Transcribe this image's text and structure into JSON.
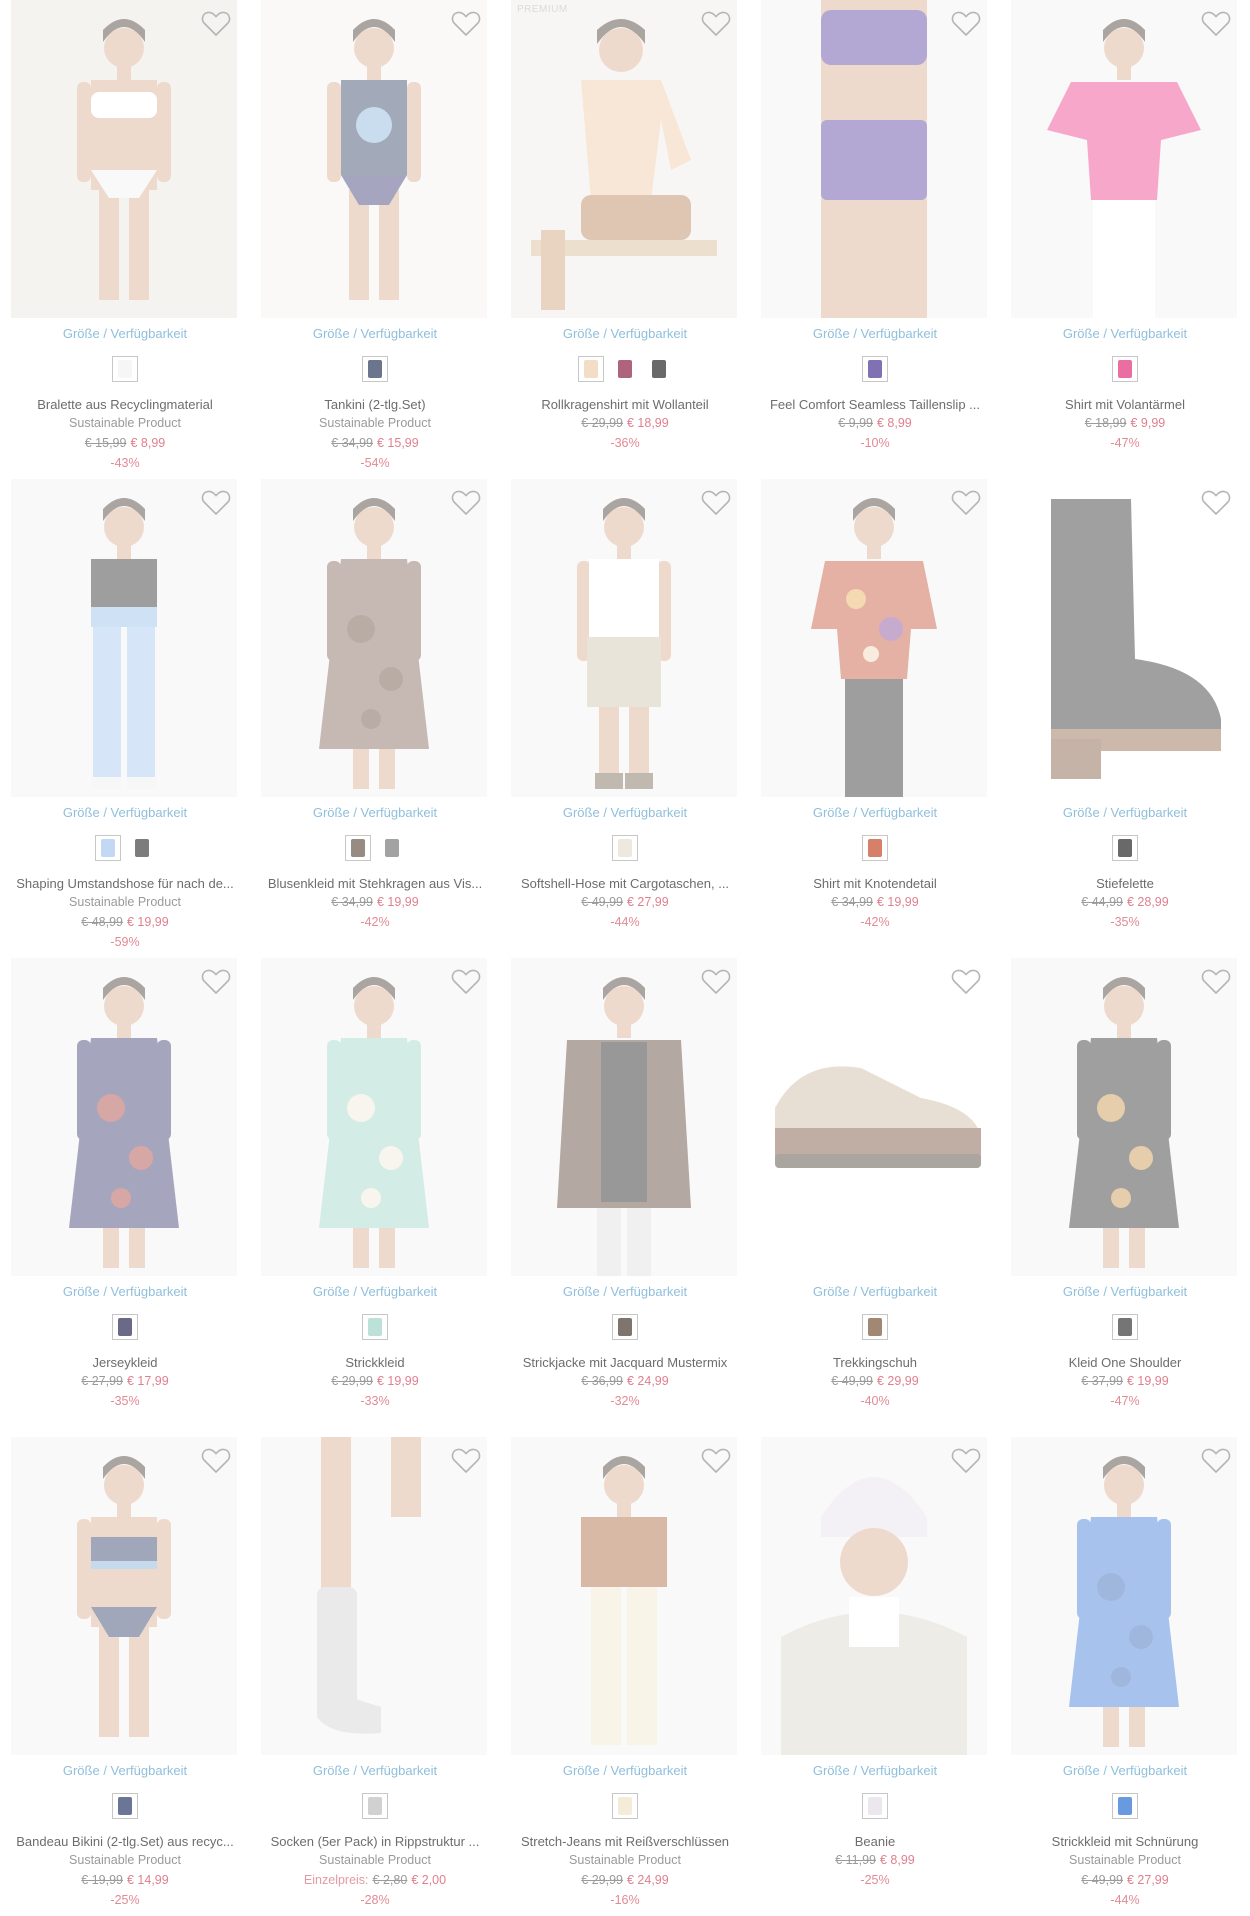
{
  "ui": {
    "size_label": "Größe / Verfügbarkeit",
    "heart_icon": "heart-outline-icon",
    "heart_color": "#b5b5b5",
    "link_color": "#8fbfdc",
    "sale_color": "#e07f8e"
  },
  "products": [
    {
      "title": "Bralette aus Recyclingmaterial",
      "subtitle": "Sustainable Product",
      "old_price": "€ 15,99",
      "price": "€ 8,99",
      "discount": "-43%",
      "swatches": [
        "#f2f2f2"
      ],
      "art": "bra",
      "bg": "#e9e4dc",
      "c1": "#ffffff",
      "c2": "#f1f1f1"
    },
    {
      "title": "Tankini (2-tlg.Set)",
      "subtitle": "Sustainable Product",
      "old_price": "€ 34,99",
      "price": "€ 15,99",
      "discount": "-54%",
      "swatches": [
        "#2d3a5e"
      ],
      "art": "tankini",
      "bg": "#f4f1ee",
      "c1": "#243457",
      "c2": "#2b2a6c"
    },
    {
      "tag": "PREMIUM",
      "title": "Rollkragenshirt mit Wollanteil",
      "old_price": "€ 29,99",
      "price": "€ 18,99",
      "discount": "-36%",
      "swatches": [
        "#efcfae",
        "#8b2344",
        "#2a2a2a"
      ],
      "art": "sit",
      "bg": "#eeeae6",
      "c1": "#efc89f",
      "c2": "#b27a4b"
    },
    {
      "title": "Feel Comfort Seamless Taillenslip ...",
      "old_price": "€ 9,99",
      "price": "€ 8,99",
      "discount": "-10%",
      "swatches": [
        "#4b3494"
      ],
      "art": "underwear",
      "bg": "#f3f2f2",
      "c1": "#4b2f98",
      "c2": "#4b2f98"
    },
    {
      "title": "Shirt mit Volantärmel",
      "old_price": "€ 18,99",
      "price": "€ 9,99",
      "discount": "-47%",
      "swatches": [
        "#e2317c"
      ],
      "art": "shirt",
      "bg": "#f4f3f3",
      "c1": "#ea2f82",
      "c2": "#ffffff"
    },
    {
      "title": "Shaping Umstandshose für nach de...",
      "subtitle": "Sustainable Product",
      "old_price": "€ 48,99",
      "price": "€ 19,99",
      "discount": "-59%",
      "swatches": [
        "#a8c8ee",
        "#444444"
      ],
      "art": "jeans",
      "bg": "#f2f2f2",
      "c1": "#1b1b1b",
      "c2": "#9ec3ef"
    },
    {
      "title": "Blusenkleid mit Stehkragen aus Vis...",
      "old_price": "€ 34,99",
      "price": "€ 19,99",
      "discount": "-42%",
      "swatches": [
        "#6b5a50",
        "#7a7a7a"
      ],
      "art": "dress",
      "bg": "#f2f2f2",
      "c1": "#7a5a4f",
      "c2": "#5a3b2b"
    },
    {
      "title": "Softshell-Hose mit Cargotaschen, ...",
      "old_price": "€ 49,99",
      "price": "€ 27,99",
      "discount": "-44%",
      "swatches": [
        "#e6e0d2"
      ],
      "art": "shorts",
      "bg": "#f2f2f2",
      "c1": "#ffffff",
      "c2": "#c9bfa8"
    },
    {
      "title": "Shirt mit Knotendetail",
      "old_price": "€ 34,99",
      "price": "€ 19,99",
      "discount": "-42%",
      "swatches": [
        "#c44a2b"
      ],
      "art": "top",
      "bg": "#f2f2f2",
      "c1": "#c2482c",
      "c2": "#1a1a1a"
    },
    {
      "title": "Stiefelette",
      "old_price": "€ 44,99",
      "price": "€ 28,99",
      "discount": "-35%",
      "swatches": [
        "#2a2a2a"
      ],
      "art": "boot",
      "bg": "#ffffff",
      "c1": "#1e1e1e",
      "c2": "#7a4b30"
    },
    {
      "title": "Jerseykleid",
      "old_price": "€ 27,99",
      "price": "€ 17,99",
      "discount": "-35%",
      "swatches": [
        "#2b2a55"
      ],
      "art": "dress",
      "bg": "#f2f2f2",
      "c1": "#2a2d63",
      "c2": "#a2302a"
    },
    {
      "title": "Strickkleid",
      "old_price": "€ 29,99",
      "price": "€ 19,99",
      "discount": "-33%",
      "swatches": [
        "#9fd4c8"
      ],
      "art": "dress",
      "bg": "#f2f2f2",
      "c1": "#9ad3c4",
      "c2": "#efe9da"
    },
    {
      "title": "Strickjacke mit Jacquard Mustermix",
      "old_price": "€ 36,99",
      "price": "€ 24,99",
      "discount": "-32%",
      "swatches": [
        "#4a3a30"
      ],
      "art": "jacket",
      "bg": "#f2f2f2",
      "c1": "#4c3324",
      "c2": "#0d0d0d"
    },
    {
      "title": "Trekkingschuh",
      "old_price": "€ 49,99",
      "price": "€ 29,99",
      "discount": "-40%",
      "swatches": [
        "#7a5436"
      ],
      "art": "shoe",
      "bg": "#ffffff",
      "c1": "#6b3d27",
      "c2": "#c9b59a"
    },
    {
      "title": "Kleid One Shoulder",
      "old_price": "€ 37,99",
      "price": "€ 19,99",
      "discount": "-47%",
      "swatches": [
        "#3a3a3a"
      ],
      "art": "dress",
      "bg": "#f2f2f2",
      "c1": "#1d1d1d",
      "c2": "#c58a3a"
    },
    {
      "title": "Bandeau Bikini (2-tlg.Set) aus recyc...",
      "subtitle": "Sustainable Product",
      "old_price": "€ 19,99",
      "price": "€ 14,99",
      "discount": "-25%",
      "swatches": [
        "#2c3a6a"
      ],
      "art": "bikini",
      "bg": "#f2f2f2",
      "c1": "#22305d",
      "c2": "#7aa9d9"
    },
    {
      "title": "Socken (5er Pack) in Rippstruktur ...",
      "subtitle": "Sustainable Product",
      "price_prefix": "Einzelpreis:",
      "old_price": "€ 2,80",
      "price": "€ 2,00",
      "discount": "-28%",
      "swatches": [
        "#bdbdbd"
      ],
      "art": "socks",
      "bg": "#f2f2f2",
      "c1": "#cfcfcf",
      "c2": "#ffffff"
    },
    {
      "title": "Stretch-Jeans mit Reißverschlüssen",
      "subtitle": "Sustainable Product",
      "old_price": "€ 29,99",
      "price": "€ 24,99",
      "discount": "-16%",
      "swatches": [
        "#efe4c8"
      ],
      "art": "pants",
      "bg": "#f2f2f2",
      "c1": "#f2e5c9",
      "c2": "#a35a2b"
    },
    {
      "title": "Beanie",
      "old_price": "€ 11,99",
      "price": "€ 8,99",
      "discount": "-25%",
      "swatches": [
        "#e4dde8"
      ],
      "art": "beanie",
      "bg": "#f2f2f2",
      "c1": "#e6dfea",
      "c2": "#d9d3c7"
    },
    {
      "title": "Strickkleid mit Schnürung",
      "subtitle": "Sustainable Product",
      "old_price": "€ 49,99",
      "price": "€ 27,99",
      "discount": "-44%",
      "swatches": [
        "#2a6ed1"
      ],
      "art": "dress",
      "bg": "#f2f2f2",
      "c1": "#2f73d6",
      "c2": "#1d55b0"
    }
  ]
}
